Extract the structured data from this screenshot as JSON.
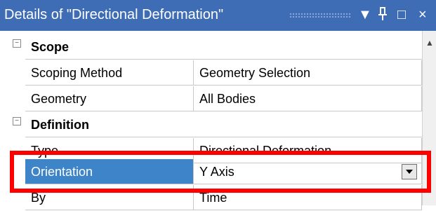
{
  "panel": {
    "title": "Details of \"Directional Deformation\"",
    "controls": {
      "dropdown": "▼",
      "pin": "Ԃ",
      "maximize": "□",
      "close": "×"
    }
  },
  "groups": [
    {
      "label": "Scope",
      "collapse_symbol": "−",
      "rows": [
        {
          "name": "Scoping Method",
          "value": "Geometry Selection"
        },
        {
          "name": "Geometry",
          "value": "All Bodies"
        }
      ]
    },
    {
      "label": "Definition",
      "collapse_symbol": "−",
      "rows": [
        {
          "name": "Type",
          "value": "Directional Deformation"
        },
        {
          "name": "Orientation",
          "value": "Y Axis"
        },
        {
          "name": "By",
          "value": "Time"
        }
      ]
    }
  ],
  "colors": {
    "titlebar": "#3e6db5",
    "selected": "#3e84c8",
    "highlight": "#ff0000"
  }
}
